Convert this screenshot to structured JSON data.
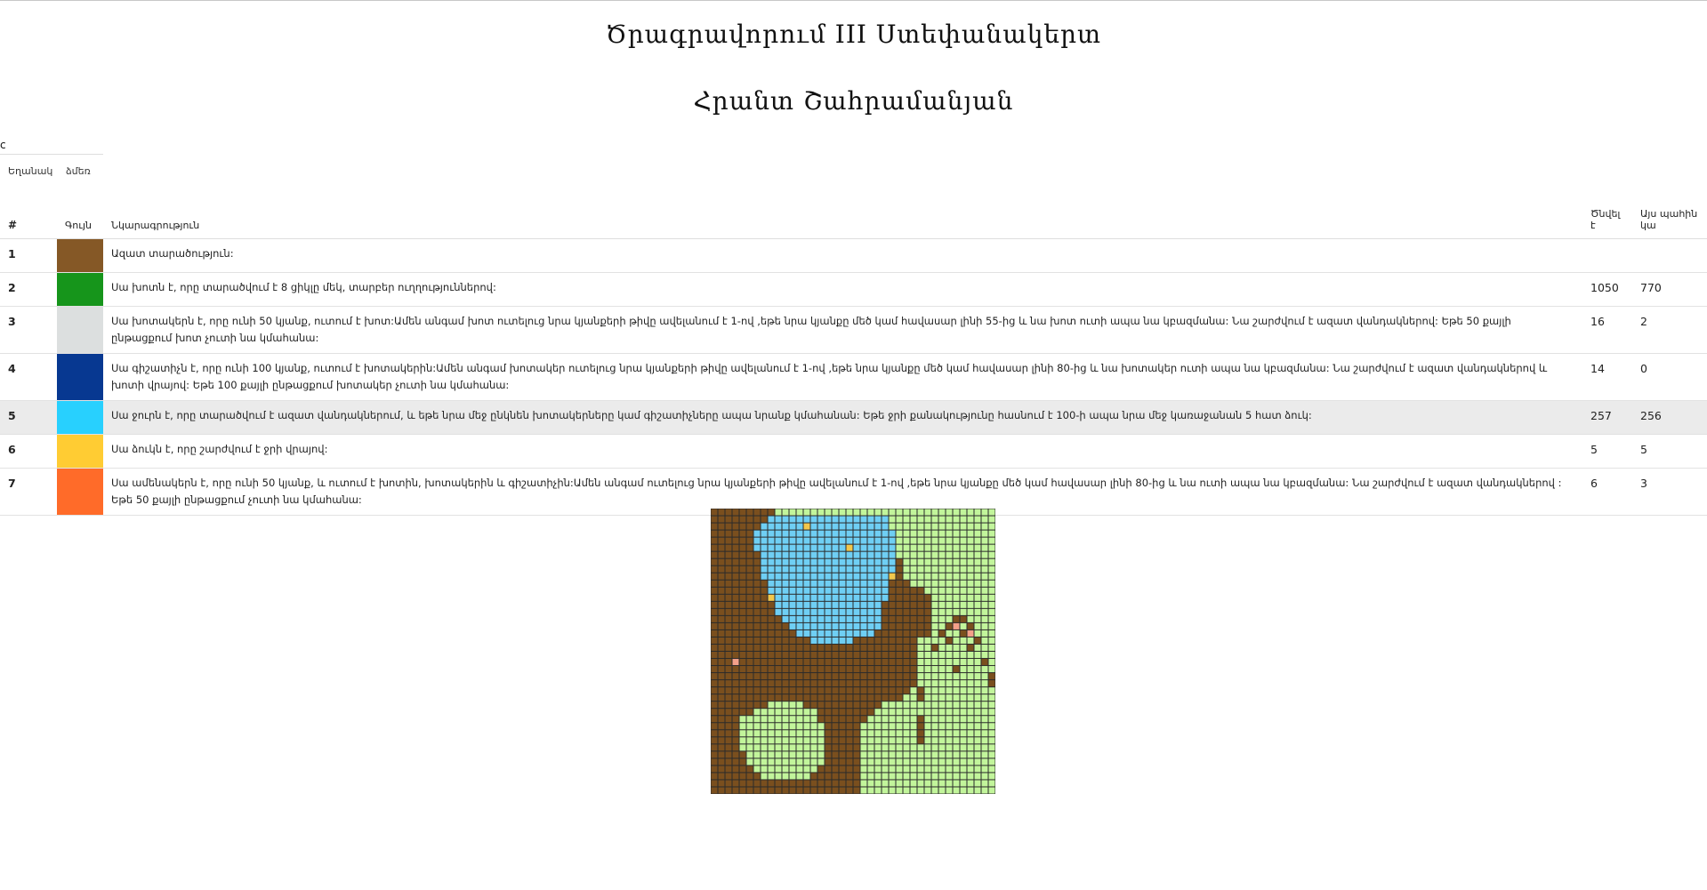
{
  "header": {
    "title": "Ծրագրավորում III Ստեփանակերտ",
    "author": "Հրանտ Շահրամանյան",
    "top_letter": "c",
    "sub_labels": [
      "Եղանակ",
      "ձմեռ"
    ]
  },
  "table": {
    "headers": {
      "num": "#",
      "color": "Գույն",
      "description": "Նկարագրություն",
      "created": "Ծնվել է",
      "current": "Այս պահին կա"
    },
    "rows": [
      {
        "n": "1",
        "color": "#855826",
        "desc": "Ազատ տարածություն:",
        "created": "",
        "current": ""
      },
      {
        "n": "2",
        "color": "#16951b",
        "desc": "Սա խոտն է, որը տարածվում է 8 ցիկլը մեկ, տարբեր ուղղություններով:",
        "created": "1050",
        "current": "770"
      },
      {
        "n": "3",
        "color": "#dcdfdf",
        "desc": "Սա խոտակերն է, որը ունի 50 կյանք, ուտում է խոտ:Ամեն անգամ խոտ ուտելուց նրա կյանքերի թիվը ավելանում է 1-ով ,եթե նրա կյանքը մեծ կամ հավասար լինի 55-ից և նա խոտ ուտի ապա նա կբազմանա: Նա շարժվում է ազատ վանդակներով: Եթե 50 քայլի ընթացքում խոտ չուտի նա կմահանա:",
        "created": "16",
        "current": "2"
      },
      {
        "n": "4",
        "color": "#073891",
        "desc": "Սա գիշատիչն է, որը ունի 100 կյանք, ուտում է խոտակերին:Ամեն անգամ խոտակեր ուտելուց նրա կյանքերի թիվը ավելանում է 1-ով ,եթե նրա կյանքը մեծ կամ հավասար լինի 80-ից և նա խոտակեր ուտի ապա նա կբազմանա: Նա շարժվում է ազատ վանդակներով և խոտի վրայով: Եթե 100 քայլի ընթացքում խոտակեր չուտի նա կմահանա:",
        "created": "14",
        "current": "0"
      },
      {
        "n": "5",
        "color": "#28d0fe",
        "desc": "Սա ջուրն է, որը տարածվում է ազատ վանդակներում, և եթե նրա մեջ ընկնեն խոտակերները կամ գիշատիչները ապա նրանք կմահանան: Եթե ջրի քանակությունը հասնում է 100-ի ապա նրա մեջ կառաջանան 5 հատ ձուկ:",
        "created": "257",
        "current": "256"
      },
      {
        "n": "6",
        "color": "#ffcc33",
        "desc": "Սա ձուկն է, որը շարժվում է ջրի վրայով:",
        "created": "5",
        "current": "5"
      },
      {
        "n": "7",
        "color": "#ff6b29",
        "desc": "Սա ամենակերն է, որը ունի 50 կյանք, և ուտում է խոտին, խոտակերին և գիշատիչին:Ամեն անգամ ուտելուց նրա կյանքերի թիվը ավելանում է 1-ով ,եթե նրա կյանքը մեծ կամ հավասար լինի 80-ից և նա ուտի ապա նա կբազմանա: Նա շարժվում է ազատ վանդակներով : Եթե 50 քայլի ընթացքում չուտի նա կմահանա:",
        "created": "6",
        "current": "3"
      }
    ],
    "highlighted_row": "5"
  },
  "grid": {
    "cols": 40,
    "rows": 40,
    "palette": {
      "0": "#7a4f1e",
      "1": "#c2f59b",
      "2": "#6fcff4",
      "3": "#f2c74c",
      "4": "#f4a08a"
    },
    "cells": [
      "0000000001111111111111111111111111111111",
      "0000000022222222222222222111111111111111",
      "0000000222222222222222222111111111111111",
      "0000002222222222222222222211111111111111",
      "0000002222222222222222222211111111111111",
      "0000002222222222222222222211111111111111",
      "0000000222222222222222222211111111111111",
      "0000000222222222222222222201111111111111",
      "0000000222222222222222222201111111111111",
      "0000000222222222222222222201111111111111",
      "0000000022222222222222222000111111111111",
      "0000000022222222222222222000001111111111",
      "0000000022222222222222222000000111111111",
      "0000000002222222222222220000000111111111",
      "0000000002222222222222220000000111111111",
      "0000000000222222222222220000000111111111",
      "0000000000022222222222220000000111111111",
      "0000000000002222222222200000000111111111",
      "0000000000000022222200000000011111111111",
      "0000000000000000000000000000011111111111",
      "0000000000000000000000000000011111111111",
      "0000000000000000000000000000011111111111",
      "0000000000000000000000000000011111111111",
      "0000000000000000000000000000011111111111",
      "0000000000000000000000000000011111111111",
      "0000000000000000000000000000111111111111",
      "0000000000000000000000000001111111111111",
      "0000000011111000000000001111111111111111",
      "0000001111111110000000011111111111111111",
      "0000111111111110000000111111111111111111",
      "0000111111111111000001111111111111111111",
      "0000111111111111000001111111111111111111",
      "0000111111111111000001111111111111111111",
      "0000111111111111000001111111111111111111",
      "0000011111111111000001111111111111111111",
      "0000011111111111000001111111111111111111",
      "0000001111111110000001111111111111111111",
      "0000000111111100000001111111111111111111",
      "0000000000000000000001111111111111111111",
      "0000000000000000000001111111111111111111"
    ],
    "specials": [
      {
        "r": 2,
        "c": 13,
        "v": "3"
      },
      {
        "r": 5,
        "c": 19,
        "v": "3"
      },
      {
        "r": 9,
        "c": 25,
        "v": "3"
      },
      {
        "r": 12,
        "c": 8,
        "v": "3"
      },
      {
        "r": 21,
        "c": 3,
        "v": "4"
      },
      {
        "r": 15,
        "c": 34,
        "v": "0"
      },
      {
        "r": 15,
        "c": 35,
        "v": "0"
      },
      {
        "r": 16,
        "c": 33,
        "v": "0"
      },
      {
        "r": 16,
        "c": 34,
        "v": "4"
      },
      {
        "r": 16,
        "c": 36,
        "v": "0"
      },
      {
        "r": 17,
        "c": 32,
        "v": "0"
      },
      {
        "r": 17,
        "c": 35,
        "v": "0"
      },
      {
        "r": 17,
        "c": 36,
        "v": "4"
      },
      {
        "r": 18,
        "c": 33,
        "v": "0"
      },
      {
        "r": 18,
        "c": 37,
        "v": "0"
      },
      {
        "r": 19,
        "c": 31,
        "v": "0"
      },
      {
        "r": 19,
        "c": 36,
        "v": "0"
      },
      {
        "r": 21,
        "c": 38,
        "v": "0"
      },
      {
        "r": 22,
        "c": 34,
        "v": "0"
      },
      {
        "r": 23,
        "c": 39,
        "v": "0"
      },
      {
        "r": 24,
        "c": 39,
        "v": "0"
      },
      {
        "r": 25,
        "c": 29,
        "v": "0"
      },
      {
        "r": 26,
        "c": 29,
        "v": "0"
      },
      {
        "r": 29,
        "c": 29,
        "v": "0"
      },
      {
        "r": 30,
        "c": 29,
        "v": "0"
      },
      {
        "r": 31,
        "c": 29,
        "v": "0"
      },
      {
        "r": 32,
        "c": 29,
        "v": "0"
      }
    ]
  }
}
